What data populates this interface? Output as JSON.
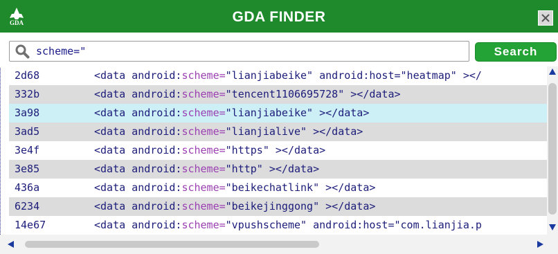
{
  "window": {
    "title": "GDA FINDER",
    "logo_text": "GDA",
    "brand_color": "#1f8a2c"
  },
  "search": {
    "value": "scheme=\"",
    "button_label": "Search"
  },
  "results": [
    {
      "addr": "2d68",
      "pre": "<data android:",
      "attr": "scheme=",
      "post": "\"lianjiabeike\" android:host=\"heatmap\" ></"
    },
    {
      "addr": "332b",
      "pre": "<data android:",
      "attr": "scheme=",
      "post": "\"tencent1106695728\" ></data>"
    },
    {
      "addr": "3a98",
      "pre": "<data android:",
      "attr": "scheme=",
      "post": "\"lianjiabeike\" ></data>"
    },
    {
      "addr": "3ad5",
      "pre": "<data android:",
      "attr": "scheme=",
      "post": "\"lianjialive\" ></data>"
    },
    {
      "addr": "3e4f",
      "pre": "<data android:",
      "attr": "scheme=",
      "post": "\"https\" ></data>"
    },
    {
      "addr": "3e85",
      "pre": "<data android:",
      "attr": "scheme=",
      "post": "\"http\" ></data>"
    },
    {
      "addr": "436a",
      "pre": "<data android:",
      "attr": "scheme=",
      "post": "\"beikechatlink\" ></data>"
    },
    {
      "addr": "6234",
      "pre": "<data android:",
      "attr": "scheme=",
      "post": "\"beikejinggong\" ></data>"
    },
    {
      "addr": "14e67",
      "pre": "<data android:",
      "attr": "scheme=",
      "post": "\"vpushscheme\" android:host=\"com.lianjia.p"
    }
  ],
  "selected_index": 2,
  "icons": {
    "close": "close-icon",
    "search": "search-icon",
    "scroll_up": "arrow-up-icon",
    "scroll_down": "arrow-down-icon",
    "scroll_left": "arrow-left-icon",
    "scroll_right": "arrow-right-icon"
  }
}
